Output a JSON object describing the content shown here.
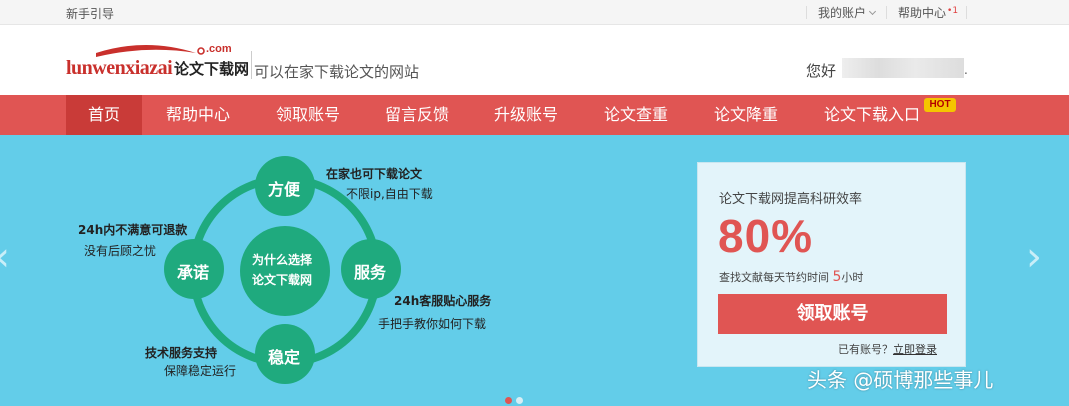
{
  "topbar": {
    "guide": "新手引导",
    "account": "我的账户",
    "help": "帮助中心",
    "help_badge": "•1"
  },
  "header": {
    "logo_en": "lunwenxiazai",
    "logo_com": ".com",
    "logo_cn": "论文下载网",
    "slogan": "可以在家下载论文的网站",
    "greeting": "您好",
    "dot": "."
  },
  "nav": {
    "items": [
      "首页",
      "帮助中心",
      "领取账号",
      "留言反馈",
      "升级账号",
      "论文查重",
      "论文降重",
      "论文下载入口"
    ],
    "hot": "HOT"
  },
  "diagram": {
    "center": [
      "为什么选择",
      "论文下载网"
    ],
    "nodes": [
      "方便",
      "服务",
      "稳定",
      "承诺"
    ],
    "notes": {
      "convenient_title": "在家也可下载论文",
      "convenient_desc": "不限ip,自由下载",
      "service_title": "24h客服贴心服务",
      "service_desc": "手把手教你如何下载",
      "stable_title": "技术服务支持",
      "stable_desc": "保障稳定运行",
      "promise_title": "24h内不满意可退款",
      "promise_desc": "没有后顾之忧"
    }
  },
  "card": {
    "title": "论文下载网提高科研效率",
    "percent": "80%",
    "save_prefix": "查找文献每天节约时间",
    "save_num": "5",
    "save_suffix": "小时",
    "button": "领取账号",
    "login_prefix": "已有账号？",
    "login_link": "立即登录"
  },
  "arrows": {
    "prev": "‹",
    "next": "›"
  },
  "watermark": "头条 @硕博那些事儿",
  "colors": {
    "brand_red": "#e05553",
    "active_red": "#c93b38",
    "banner_blue": "#63cde9",
    "circle_green": "#1faa7e"
  }
}
